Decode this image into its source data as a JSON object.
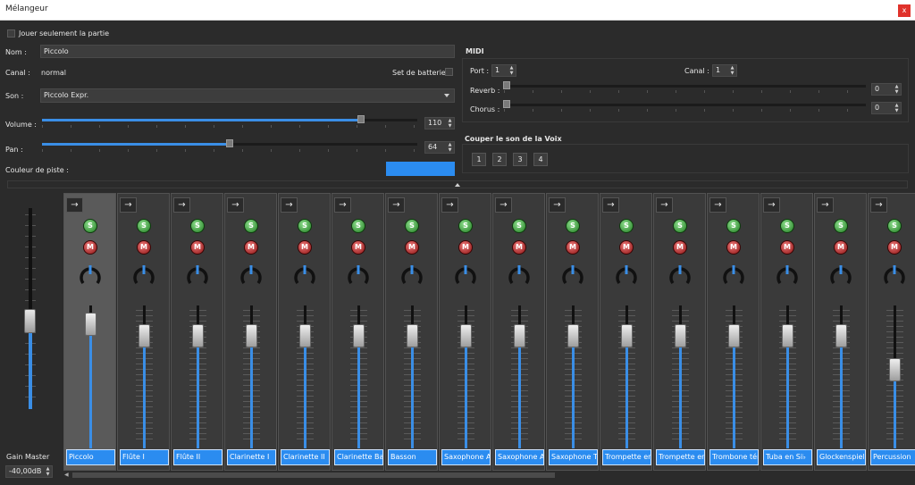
{
  "window": {
    "title": "Mélangeur",
    "close_label": "x"
  },
  "part": {
    "play_only_part_label": "Jouer seulement la partie",
    "name_label": "Nom :",
    "name_value": "Piccolo",
    "channel_label": "Canal :",
    "channel_value": "normal",
    "drumset_label": "Set de batterie",
    "sound_label": "Son :",
    "sound_value": "Piccolo Expr.",
    "volume_label": "Volume :",
    "volume_value": "110",
    "pan_label": "Pan :",
    "pan_value": "64",
    "track_color_label": "Couleur de piste :",
    "track_color": "#2b8cf0"
  },
  "midi": {
    "title": "MIDI",
    "port_label": "Port :",
    "port_value": "1",
    "channel_label": "Canal :",
    "channel_value": "1",
    "reverb_label": "Reverb :",
    "reverb_value": "0",
    "chorus_label": "Chorus :",
    "chorus_value": "0"
  },
  "mute_voice": {
    "title": "Couper le son de la Voix",
    "voices": [
      "1",
      "2",
      "3",
      "4"
    ]
  },
  "master": {
    "label": "Gain Master",
    "value": "-40,00dB"
  },
  "strip_buttons": {
    "route": "→",
    "solo": "S",
    "mute": "M"
  },
  "strips": [
    {
      "name": "Piccolo",
      "volume": 110,
      "selected": true
    },
    {
      "name": "Flûte I",
      "volume": 100
    },
    {
      "name": "Flûte II",
      "volume": 100
    },
    {
      "name": "Clarinette I",
      "volume": 100
    },
    {
      "name": "Clarinette II",
      "volume": 100
    },
    {
      "name": "Clarinette Bass",
      "volume": 100
    },
    {
      "name": "Basson",
      "volume": 100
    },
    {
      "name": "Saxophone Alto",
      "volume": 100
    },
    {
      "name": "Saxophone Alto",
      "volume": 100
    },
    {
      "name": "Saxophone Ténor",
      "volume": 100
    },
    {
      "name": "Trompette en",
      "volume": 100
    },
    {
      "name": "Trompette en",
      "volume": 100
    },
    {
      "name": "Trombone ténor",
      "volume": 100
    },
    {
      "name": "Tuba en Si♭",
      "volume": 100
    },
    {
      "name": "Glockenspiel",
      "volume": 100
    },
    {
      "name": "Percussion",
      "volume": 70
    }
  ],
  "colors": {
    "accent": "#2b8cf0",
    "background": "#2b2b2b"
  }
}
